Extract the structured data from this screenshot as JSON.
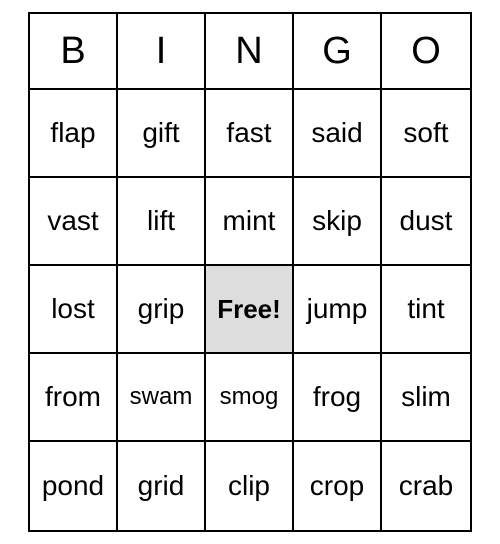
{
  "headers": [
    "B",
    "I",
    "N",
    "G",
    "O"
  ],
  "grid": [
    [
      "flap",
      "gift",
      "fast",
      "said",
      "soft"
    ],
    [
      "vast",
      "lift",
      "mint",
      "skip",
      "dust"
    ],
    [
      "lost",
      "grip",
      "Free!",
      "jump",
      "tint"
    ],
    [
      "from",
      "swam",
      "smog",
      "frog",
      "slim"
    ],
    [
      "pond",
      "grid",
      "clip",
      "crop",
      "crab"
    ]
  ],
  "freeCell": {
    "row": 2,
    "col": 2
  },
  "smallCells": [
    {
      "row": 3,
      "col": 1
    },
    {
      "row": 3,
      "col": 2
    }
  ]
}
